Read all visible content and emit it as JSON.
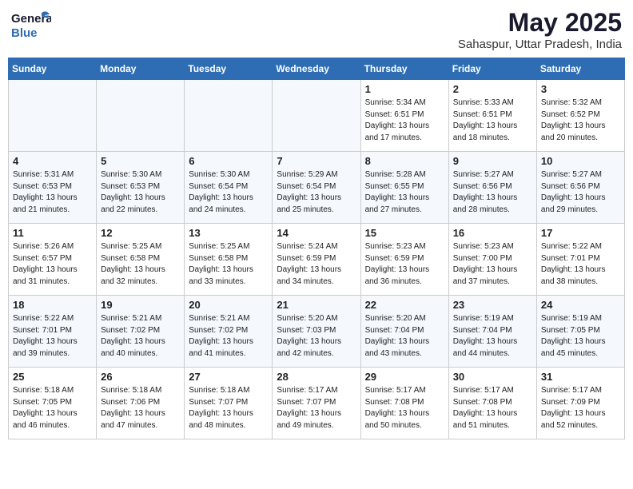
{
  "header": {
    "logo_line1": "General",
    "logo_line2": "Blue",
    "month": "May 2025",
    "location": "Sahaspur, Uttar Pradesh, India"
  },
  "weekdays": [
    "Sunday",
    "Monday",
    "Tuesday",
    "Wednesday",
    "Thursday",
    "Friday",
    "Saturday"
  ],
  "weeks": [
    [
      {
        "day": "",
        "empty": true
      },
      {
        "day": "",
        "empty": true
      },
      {
        "day": "",
        "empty": true
      },
      {
        "day": "",
        "empty": true
      },
      {
        "day": "1",
        "sunrise": "5:34 AM",
        "sunset": "6:51 PM",
        "daylight": "13 hours and 17 minutes."
      },
      {
        "day": "2",
        "sunrise": "5:33 AM",
        "sunset": "6:51 PM",
        "daylight": "13 hours and 18 minutes."
      },
      {
        "day": "3",
        "sunrise": "5:32 AM",
        "sunset": "6:52 PM",
        "daylight": "13 hours and 20 minutes."
      }
    ],
    [
      {
        "day": "4",
        "sunrise": "5:31 AM",
        "sunset": "6:53 PM",
        "daylight": "13 hours and 21 minutes."
      },
      {
        "day": "5",
        "sunrise": "5:30 AM",
        "sunset": "6:53 PM",
        "daylight": "13 hours and 22 minutes."
      },
      {
        "day": "6",
        "sunrise": "5:30 AM",
        "sunset": "6:54 PM",
        "daylight": "13 hours and 24 minutes."
      },
      {
        "day": "7",
        "sunrise": "5:29 AM",
        "sunset": "6:54 PM",
        "daylight": "13 hours and 25 minutes."
      },
      {
        "day": "8",
        "sunrise": "5:28 AM",
        "sunset": "6:55 PM",
        "daylight": "13 hours and 27 minutes."
      },
      {
        "day": "9",
        "sunrise": "5:27 AM",
        "sunset": "6:56 PM",
        "daylight": "13 hours and 28 minutes."
      },
      {
        "day": "10",
        "sunrise": "5:27 AM",
        "sunset": "6:56 PM",
        "daylight": "13 hours and 29 minutes."
      }
    ],
    [
      {
        "day": "11",
        "sunrise": "5:26 AM",
        "sunset": "6:57 PM",
        "daylight": "13 hours and 31 minutes."
      },
      {
        "day": "12",
        "sunrise": "5:25 AM",
        "sunset": "6:58 PM",
        "daylight": "13 hours and 32 minutes."
      },
      {
        "day": "13",
        "sunrise": "5:25 AM",
        "sunset": "6:58 PM",
        "daylight": "13 hours and 33 minutes."
      },
      {
        "day": "14",
        "sunrise": "5:24 AM",
        "sunset": "6:59 PM",
        "daylight": "13 hours and 34 minutes."
      },
      {
        "day": "15",
        "sunrise": "5:23 AM",
        "sunset": "6:59 PM",
        "daylight": "13 hours and 36 minutes."
      },
      {
        "day": "16",
        "sunrise": "5:23 AM",
        "sunset": "7:00 PM",
        "daylight": "13 hours and 37 minutes."
      },
      {
        "day": "17",
        "sunrise": "5:22 AM",
        "sunset": "7:01 PM",
        "daylight": "13 hours and 38 minutes."
      }
    ],
    [
      {
        "day": "18",
        "sunrise": "5:22 AM",
        "sunset": "7:01 PM",
        "daylight": "13 hours and 39 minutes."
      },
      {
        "day": "19",
        "sunrise": "5:21 AM",
        "sunset": "7:02 PM",
        "daylight": "13 hours and 40 minutes."
      },
      {
        "day": "20",
        "sunrise": "5:21 AM",
        "sunset": "7:02 PM",
        "daylight": "13 hours and 41 minutes."
      },
      {
        "day": "21",
        "sunrise": "5:20 AM",
        "sunset": "7:03 PM",
        "daylight": "13 hours and 42 minutes."
      },
      {
        "day": "22",
        "sunrise": "5:20 AM",
        "sunset": "7:04 PM",
        "daylight": "13 hours and 43 minutes."
      },
      {
        "day": "23",
        "sunrise": "5:19 AM",
        "sunset": "7:04 PM",
        "daylight": "13 hours and 44 minutes."
      },
      {
        "day": "24",
        "sunrise": "5:19 AM",
        "sunset": "7:05 PM",
        "daylight": "13 hours and 45 minutes."
      }
    ],
    [
      {
        "day": "25",
        "sunrise": "5:18 AM",
        "sunset": "7:05 PM",
        "daylight": "13 hours and 46 minutes."
      },
      {
        "day": "26",
        "sunrise": "5:18 AM",
        "sunset": "7:06 PM",
        "daylight": "13 hours and 47 minutes."
      },
      {
        "day": "27",
        "sunrise": "5:18 AM",
        "sunset": "7:07 PM",
        "daylight": "13 hours and 48 minutes."
      },
      {
        "day": "28",
        "sunrise": "5:17 AM",
        "sunset": "7:07 PM",
        "daylight": "13 hours and 49 minutes."
      },
      {
        "day": "29",
        "sunrise": "5:17 AM",
        "sunset": "7:08 PM",
        "daylight": "13 hours and 50 minutes."
      },
      {
        "day": "30",
        "sunrise": "5:17 AM",
        "sunset": "7:08 PM",
        "daylight": "13 hours and 51 minutes."
      },
      {
        "day": "31",
        "sunrise": "5:17 AM",
        "sunset": "7:09 PM",
        "daylight": "13 hours and 52 minutes."
      }
    ]
  ]
}
